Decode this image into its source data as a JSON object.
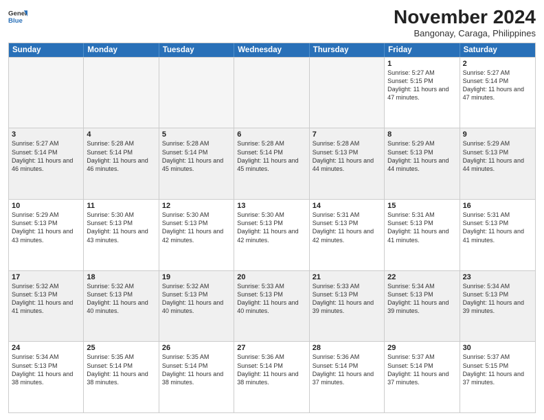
{
  "header": {
    "logo_line1": "General",
    "logo_line2": "Blue",
    "month_year": "November 2024",
    "location": "Bangonay, Caraga, Philippines"
  },
  "weekdays": [
    "Sunday",
    "Monday",
    "Tuesday",
    "Wednesday",
    "Thursday",
    "Friday",
    "Saturday"
  ],
  "rows": [
    [
      {
        "day": "",
        "info": "",
        "empty": true
      },
      {
        "day": "",
        "info": "",
        "empty": true
      },
      {
        "day": "",
        "info": "",
        "empty": true
      },
      {
        "day": "",
        "info": "",
        "empty": true
      },
      {
        "day": "",
        "info": "",
        "empty": true
      },
      {
        "day": "1",
        "info": "Sunrise: 5:27 AM\nSunset: 5:15 PM\nDaylight: 11 hours and 47 minutes.",
        "empty": false
      },
      {
        "day": "2",
        "info": "Sunrise: 5:27 AM\nSunset: 5:14 PM\nDaylight: 11 hours and 47 minutes.",
        "empty": false
      }
    ],
    [
      {
        "day": "3",
        "info": "Sunrise: 5:27 AM\nSunset: 5:14 PM\nDaylight: 11 hours and 46 minutes.",
        "empty": false
      },
      {
        "day": "4",
        "info": "Sunrise: 5:28 AM\nSunset: 5:14 PM\nDaylight: 11 hours and 46 minutes.",
        "empty": false
      },
      {
        "day": "5",
        "info": "Sunrise: 5:28 AM\nSunset: 5:14 PM\nDaylight: 11 hours and 45 minutes.",
        "empty": false
      },
      {
        "day": "6",
        "info": "Sunrise: 5:28 AM\nSunset: 5:14 PM\nDaylight: 11 hours and 45 minutes.",
        "empty": false
      },
      {
        "day": "7",
        "info": "Sunrise: 5:28 AM\nSunset: 5:13 PM\nDaylight: 11 hours and 44 minutes.",
        "empty": false
      },
      {
        "day": "8",
        "info": "Sunrise: 5:29 AM\nSunset: 5:13 PM\nDaylight: 11 hours and 44 minutes.",
        "empty": false
      },
      {
        "day": "9",
        "info": "Sunrise: 5:29 AM\nSunset: 5:13 PM\nDaylight: 11 hours and 44 minutes.",
        "empty": false
      }
    ],
    [
      {
        "day": "10",
        "info": "Sunrise: 5:29 AM\nSunset: 5:13 PM\nDaylight: 11 hours and 43 minutes.",
        "empty": false
      },
      {
        "day": "11",
        "info": "Sunrise: 5:30 AM\nSunset: 5:13 PM\nDaylight: 11 hours and 43 minutes.",
        "empty": false
      },
      {
        "day": "12",
        "info": "Sunrise: 5:30 AM\nSunset: 5:13 PM\nDaylight: 11 hours and 42 minutes.",
        "empty": false
      },
      {
        "day": "13",
        "info": "Sunrise: 5:30 AM\nSunset: 5:13 PM\nDaylight: 11 hours and 42 minutes.",
        "empty": false
      },
      {
        "day": "14",
        "info": "Sunrise: 5:31 AM\nSunset: 5:13 PM\nDaylight: 11 hours and 42 minutes.",
        "empty": false
      },
      {
        "day": "15",
        "info": "Sunrise: 5:31 AM\nSunset: 5:13 PM\nDaylight: 11 hours and 41 minutes.",
        "empty": false
      },
      {
        "day": "16",
        "info": "Sunrise: 5:31 AM\nSunset: 5:13 PM\nDaylight: 11 hours and 41 minutes.",
        "empty": false
      }
    ],
    [
      {
        "day": "17",
        "info": "Sunrise: 5:32 AM\nSunset: 5:13 PM\nDaylight: 11 hours and 41 minutes.",
        "empty": false
      },
      {
        "day": "18",
        "info": "Sunrise: 5:32 AM\nSunset: 5:13 PM\nDaylight: 11 hours and 40 minutes.",
        "empty": false
      },
      {
        "day": "19",
        "info": "Sunrise: 5:32 AM\nSunset: 5:13 PM\nDaylight: 11 hours and 40 minutes.",
        "empty": false
      },
      {
        "day": "20",
        "info": "Sunrise: 5:33 AM\nSunset: 5:13 PM\nDaylight: 11 hours and 40 minutes.",
        "empty": false
      },
      {
        "day": "21",
        "info": "Sunrise: 5:33 AM\nSunset: 5:13 PM\nDaylight: 11 hours and 39 minutes.",
        "empty": false
      },
      {
        "day": "22",
        "info": "Sunrise: 5:34 AM\nSunset: 5:13 PM\nDaylight: 11 hours and 39 minutes.",
        "empty": false
      },
      {
        "day": "23",
        "info": "Sunrise: 5:34 AM\nSunset: 5:13 PM\nDaylight: 11 hours and 39 minutes.",
        "empty": false
      }
    ],
    [
      {
        "day": "24",
        "info": "Sunrise: 5:34 AM\nSunset: 5:13 PM\nDaylight: 11 hours and 38 minutes.",
        "empty": false
      },
      {
        "day": "25",
        "info": "Sunrise: 5:35 AM\nSunset: 5:14 PM\nDaylight: 11 hours and 38 minutes.",
        "empty": false
      },
      {
        "day": "26",
        "info": "Sunrise: 5:35 AM\nSunset: 5:14 PM\nDaylight: 11 hours and 38 minutes.",
        "empty": false
      },
      {
        "day": "27",
        "info": "Sunrise: 5:36 AM\nSunset: 5:14 PM\nDaylight: 11 hours and 38 minutes.",
        "empty": false
      },
      {
        "day": "28",
        "info": "Sunrise: 5:36 AM\nSunset: 5:14 PM\nDaylight: 11 hours and 37 minutes.",
        "empty": false
      },
      {
        "day": "29",
        "info": "Sunrise: 5:37 AM\nSunset: 5:14 PM\nDaylight: 11 hours and 37 minutes.",
        "empty": false
      },
      {
        "day": "30",
        "info": "Sunrise: 5:37 AM\nSunset: 5:15 PM\nDaylight: 11 hours and 37 minutes.",
        "empty": false
      }
    ]
  ]
}
